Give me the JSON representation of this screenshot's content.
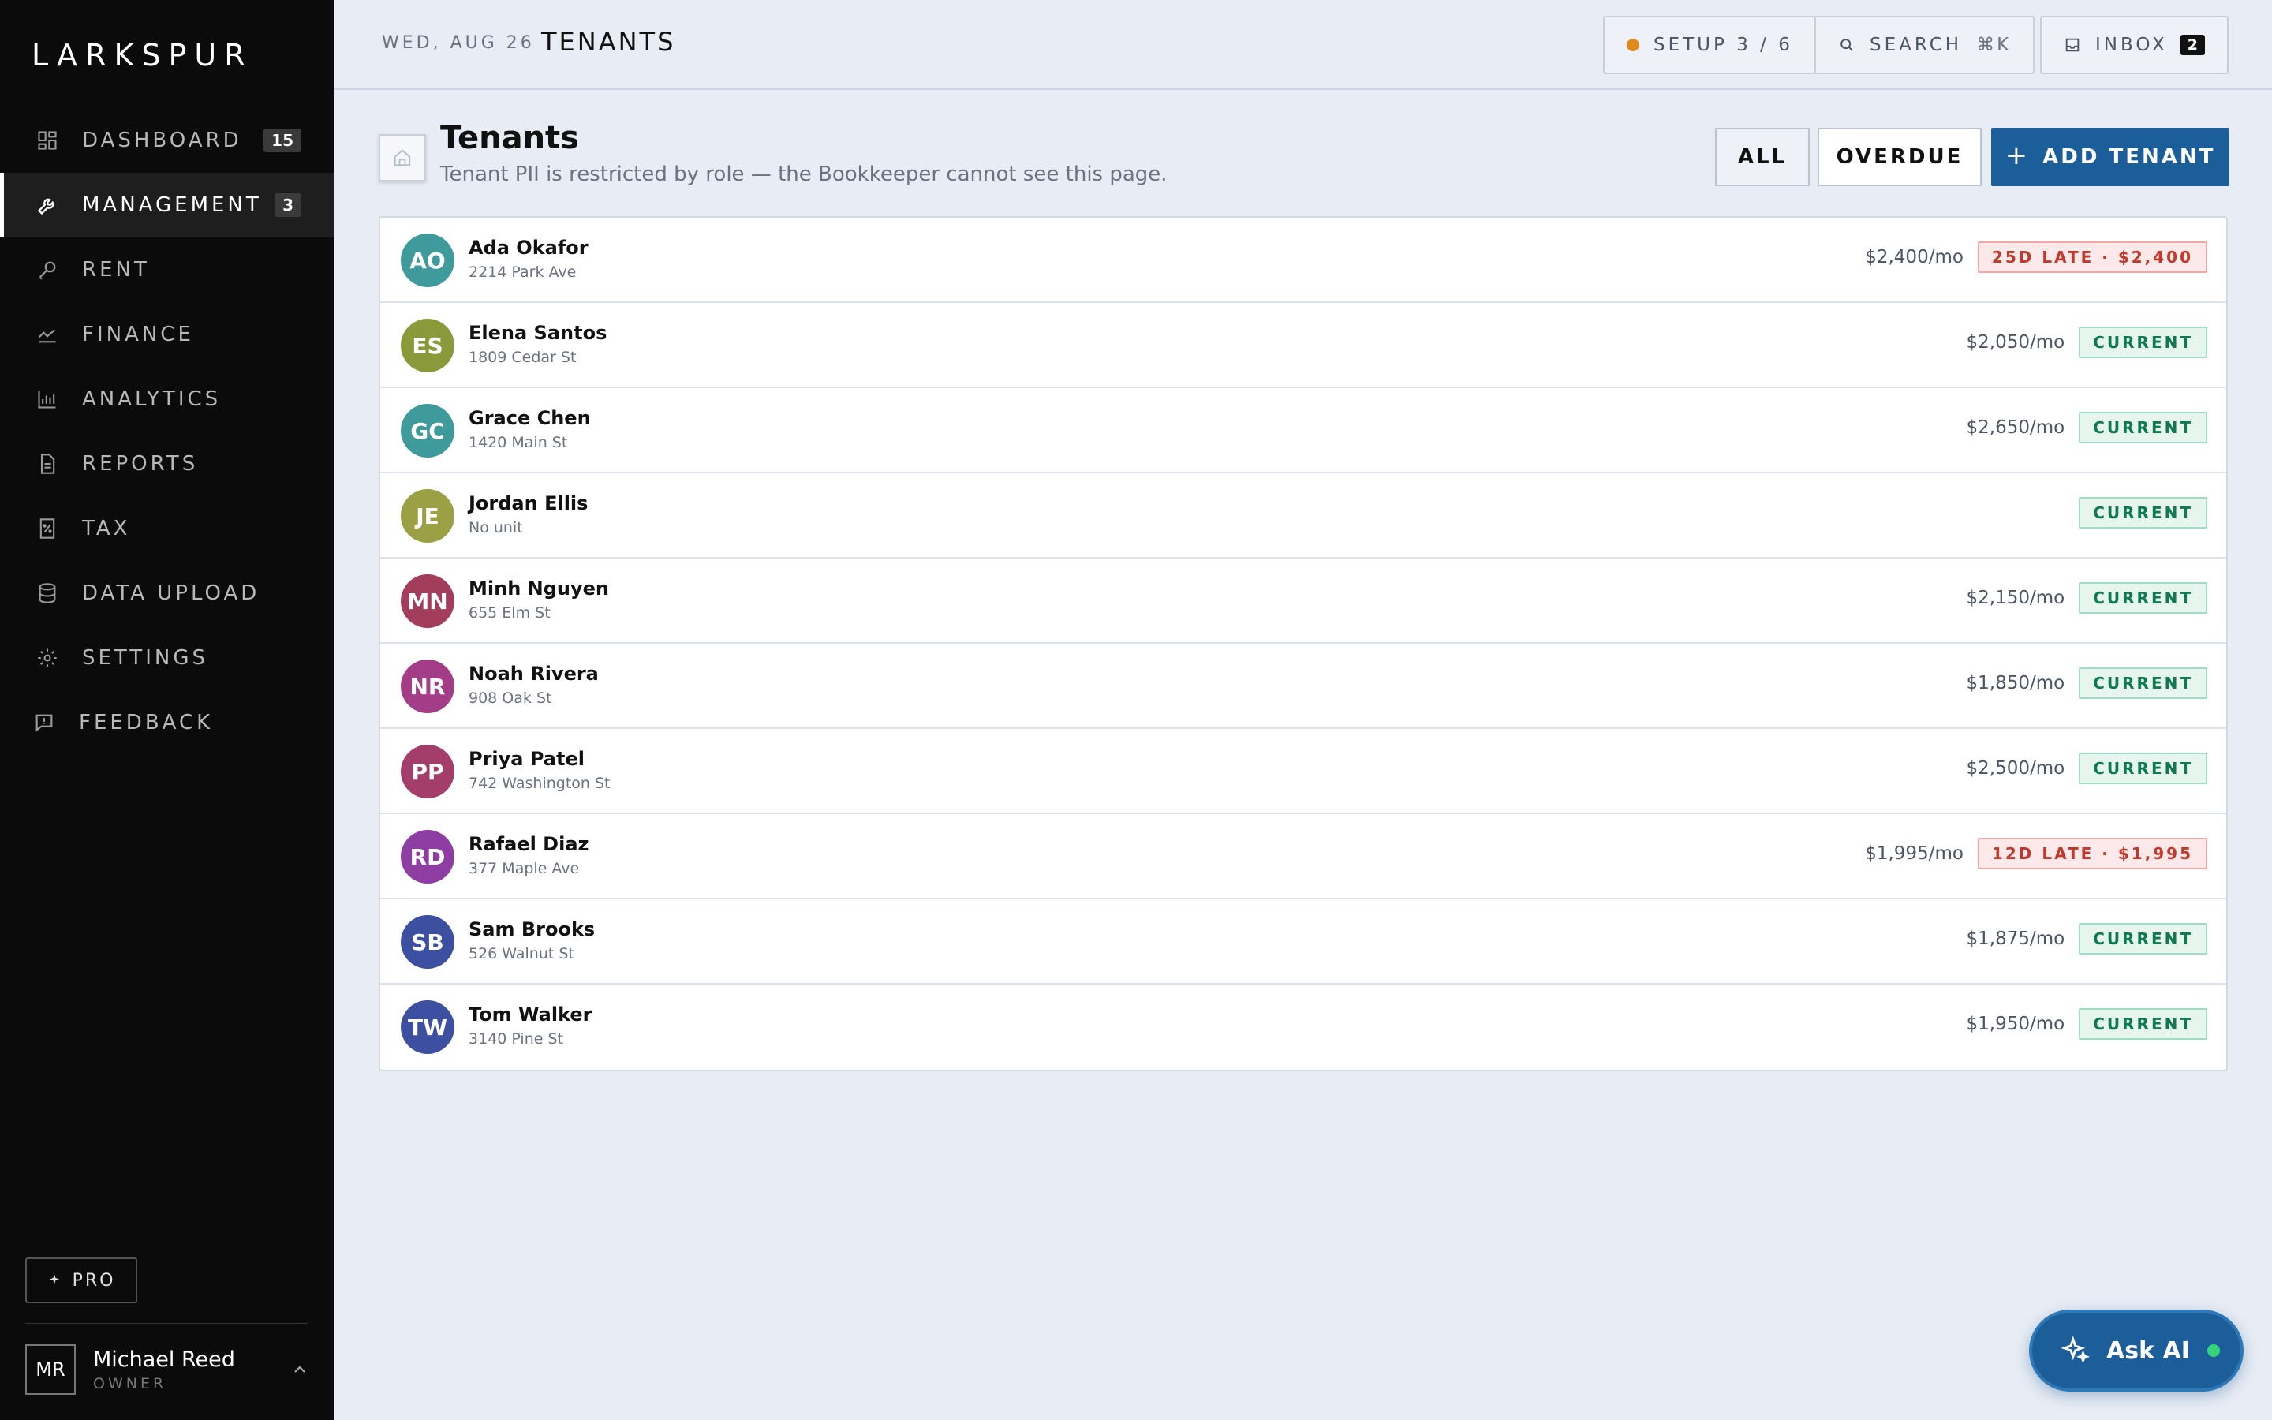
{
  "brand": {
    "logo": "LARKSPUR",
    "accent": "#1c5e99"
  },
  "sidebar": {
    "items": [
      {
        "label": "DASHBOARD",
        "icon": "dashboard-icon",
        "badge": "15"
      },
      {
        "label": "MANAGEMENT",
        "icon": "wrench-icon",
        "badge": "3",
        "active": true
      },
      {
        "label": "RENT",
        "icon": "key-icon"
      },
      {
        "label": "FINANCE",
        "icon": "trend-line-icon"
      },
      {
        "label": "ANALYTICS",
        "icon": "bar-chart-icon"
      },
      {
        "label": "REPORTS",
        "icon": "document-icon"
      },
      {
        "label": "TAX",
        "icon": "receipt-icon"
      },
      {
        "label": "DATA UPLOAD",
        "icon": "database-icon"
      },
      {
        "label": "SETTINGS",
        "icon": "gear-icon"
      },
      {
        "label": "FEEDBACK",
        "icon": "feedback-icon"
      }
    ],
    "pro_label": "PRO",
    "user": {
      "initials": "MR",
      "name": "Michael Reed",
      "role": "OWNER"
    }
  },
  "topbar": {
    "date": "WED, AUG 26",
    "title": "TENANTS",
    "setup_label": "SETUP 3 / 6",
    "search_label": "SEARCH",
    "search_shortcut": "⌘K",
    "inbox_label": "INBOX",
    "inbox_count": "2"
  },
  "page": {
    "title": "Tenants",
    "subtitle": "Tenant PII is restricted by role — the Bookkeeper cannot see this page.",
    "filter_all": "ALL",
    "filter_overdue": "OVERDUE",
    "add_label": "ADD TENANT"
  },
  "tenants": [
    {
      "initials": "AO",
      "name": "Ada Okafor",
      "address": "2214 Park Ave",
      "rent": "$2,400/mo",
      "status": "25D LATE · $2,400",
      "status_type": "late",
      "color": "#3f9a9c"
    },
    {
      "initials": "ES",
      "name": "Elena Santos",
      "address": "1809 Cedar St",
      "rent": "$2,050/mo",
      "status": "CURRENT",
      "status_type": "current",
      "color": "#8a9a3a"
    },
    {
      "initials": "GC",
      "name": "Grace Chen",
      "address": "1420 Main St",
      "rent": "$2,650/mo",
      "status": "CURRENT",
      "status_type": "current",
      "color": "#3f9a9c"
    },
    {
      "initials": "JE",
      "name": "Jordan Ellis",
      "address": "No unit",
      "rent": "",
      "status": "CURRENT",
      "status_type": "current",
      "color": "#9aa043"
    },
    {
      "initials": "MN",
      "name": "Minh Nguyen",
      "address": "655 Elm St",
      "rent": "$2,150/mo",
      "status": "CURRENT",
      "status_type": "current",
      "color": "#a33d5c"
    },
    {
      "initials": "NR",
      "name": "Noah Rivera",
      "address": "908 Oak St",
      "rent": "$1,850/mo",
      "status": "CURRENT",
      "status_type": "current",
      "color": "#a33d88"
    },
    {
      "initials": "PP",
      "name": "Priya Patel",
      "address": "742 Washington St",
      "rent": "$2,500/mo",
      "status": "CURRENT",
      "status_type": "current",
      "color": "#a33d6a"
    },
    {
      "initials": "RD",
      "name": "Rafael Diaz",
      "address": "377 Maple Ave",
      "rent": "$1,995/mo",
      "status": "12D LATE · $1,995",
      "status_type": "late",
      "color": "#8e3da3"
    },
    {
      "initials": "SB",
      "name": "Sam Brooks",
      "address": "526 Walnut St",
      "rent": "$1,875/mo",
      "status": "CURRENT",
      "status_type": "current",
      "color": "#3d4fa0"
    },
    {
      "initials": "TW",
      "name": "Tom Walker",
      "address": "3140 Pine St",
      "rent": "$1,950/mo",
      "status": "CURRENT",
      "status_type": "current",
      "color": "#3d4fa0"
    }
  ],
  "ask_ai": {
    "label": "Ask AI"
  }
}
